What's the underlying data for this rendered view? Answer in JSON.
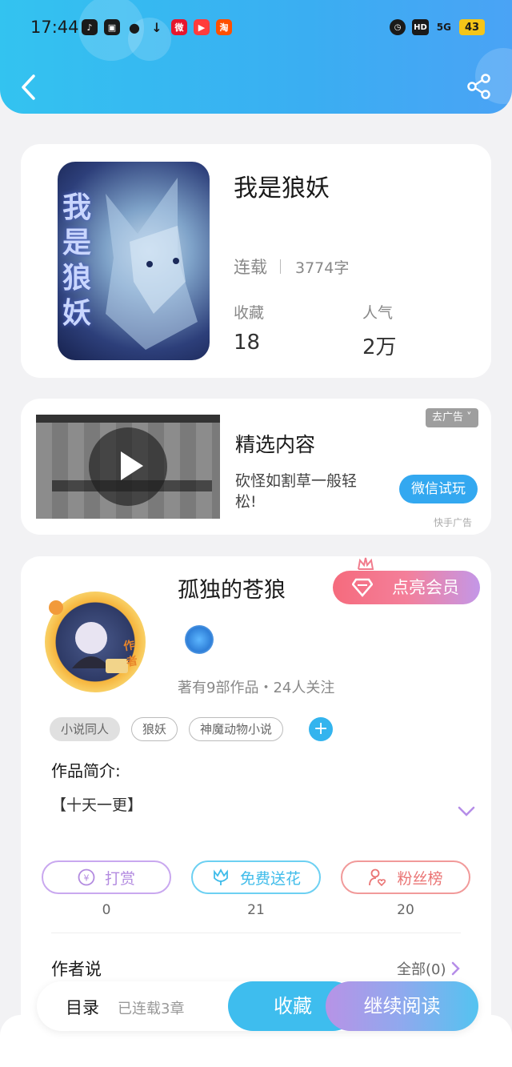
{
  "status_bar": {
    "time": "17:44",
    "network": "5G",
    "hd": "HD",
    "battery": "43"
  },
  "book": {
    "title": "我是狼妖",
    "cover_title": "我是狼妖",
    "status": "连载",
    "word_count": "3774字",
    "favorites_label": "收藏",
    "favorites_value": "18",
    "popularity_label": "人气",
    "popularity_value": "2万"
  },
  "ad": {
    "title": "精选内容",
    "description": "砍怪如割草一般轻松!",
    "button": "微信试玩",
    "remove_label": "去广告",
    "source": "快手广告"
  },
  "author": {
    "name": "孤独的苍狼",
    "avatar_tag": "作者",
    "vip_button": "点亮会员",
    "info": "著有9部作品・24人关注",
    "tags": [
      "小说同人",
      "狼妖",
      "神魔动物小说"
    ],
    "intro_label": "作品简介:",
    "intro_text": "【十天一更】",
    "actions": [
      {
        "label": "打赏",
        "count": "0",
        "color": "#b38be0"
      },
      {
        "label": "免费送花",
        "count": "21",
        "color": "#4ec3ee"
      },
      {
        "label": "粉丝榜",
        "count": "20",
        "color": "#ee7f7f"
      }
    ],
    "says_label": "作者说",
    "all_link": "全部(0)"
  },
  "bottom": {
    "toc": "目录",
    "chapters": "已连载3章",
    "favorite": "收藏",
    "continue": "继续阅读"
  }
}
